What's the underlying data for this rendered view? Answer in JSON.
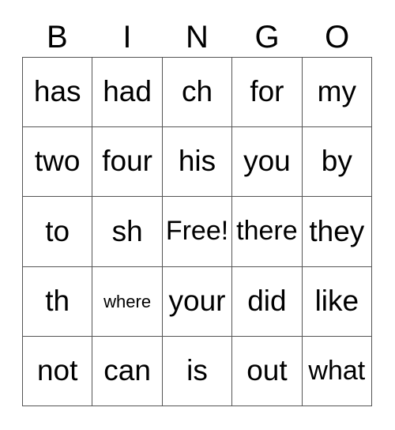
{
  "card": {
    "title": "BINGO",
    "header_letters": [
      "B",
      "I",
      "N",
      "G",
      "O"
    ],
    "free_space_label": "Free!",
    "colors": {
      "background": "#ffffff",
      "text": "#000000",
      "grid_line": "#555555"
    },
    "grid": {
      "columns": 5,
      "rows": 5,
      "cells": [
        [
          {
            "text": "has",
            "fit": "normal"
          },
          {
            "text": "had",
            "fit": "normal"
          },
          {
            "text": "ch",
            "fit": "normal"
          },
          {
            "text": "for",
            "fit": "normal"
          },
          {
            "text": "my",
            "fit": "normal"
          }
        ],
        [
          {
            "text": "two",
            "fit": "normal"
          },
          {
            "text": "four",
            "fit": "normal"
          },
          {
            "text": "his",
            "fit": "normal"
          },
          {
            "text": "you",
            "fit": "normal"
          },
          {
            "text": "by",
            "fit": "normal"
          }
        ],
        [
          {
            "text": "to",
            "fit": "normal"
          },
          {
            "text": "sh",
            "fit": "normal"
          },
          {
            "text": "Free!",
            "fit": "medium"
          },
          {
            "text": "there",
            "fit": "medium"
          },
          {
            "text": "they",
            "fit": "normal"
          }
        ],
        [
          {
            "text": "th",
            "fit": "normal"
          },
          {
            "text": "where",
            "fit": "small"
          },
          {
            "text": "your",
            "fit": "normal"
          },
          {
            "text": "did",
            "fit": "normal"
          },
          {
            "text": "like",
            "fit": "normal"
          }
        ],
        [
          {
            "text": "not",
            "fit": "normal"
          },
          {
            "text": "can",
            "fit": "normal"
          },
          {
            "text": "is",
            "fit": "normal"
          },
          {
            "text": "out",
            "fit": "normal"
          },
          {
            "text": "what",
            "fit": "medium"
          }
        ]
      ]
    }
  }
}
